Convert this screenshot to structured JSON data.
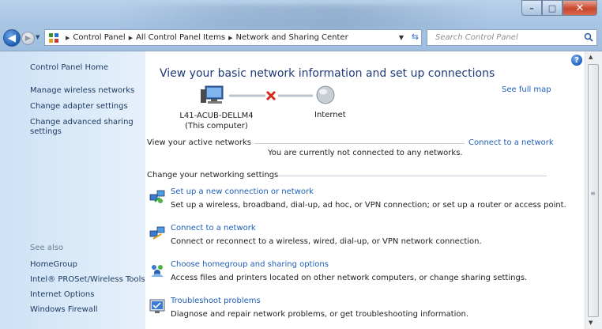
{
  "window": {
    "minimize_glyph": "–",
    "maximize_glyph": "□",
    "close_glyph": "✕"
  },
  "navigation": {
    "breadcrumbs": [
      "Control Panel",
      "All Control Panel Items",
      "Network and Sharing Center"
    ],
    "search_placeholder": "Search Control Panel"
  },
  "sidebar": {
    "home": "Control Panel Home",
    "links": [
      "Manage wireless networks",
      "Change adapter settings",
      "Change advanced sharing",
      "settings"
    ],
    "see_also_label": "See also",
    "see_also": [
      "HomeGroup",
      "Intel® PROSet/Wireless Tools",
      "Internet Options",
      "Windows Firewall"
    ]
  },
  "main": {
    "title": "View your basic network information and set up connections",
    "see_full_map": "See full map",
    "computer_name": "L41-ACUB-DELLM4",
    "computer_sub": "(This computer)",
    "internet_label": "Internet",
    "active_networks_label": "View your active networks",
    "connect_link": "Connect to a network",
    "not_connected": "You are currently not connected to any networks.",
    "settings_label": "Change your networking settings",
    "tasks": [
      {
        "title": "Set up a new connection or network",
        "desc": "Set up a wireless, broadband, dial-up, ad hoc, or VPN connection; or set up a router or access point.",
        "icon": "network-setup-icon"
      },
      {
        "title": "Connect to a network",
        "desc": "Connect or reconnect to a wireless, wired, dial-up, or VPN network connection.",
        "icon": "connect-network-icon"
      },
      {
        "title": "Choose homegroup and sharing options",
        "desc": "Access files and printers located on other network computers, or change sharing settings.",
        "icon": "homegroup-icon"
      },
      {
        "title": "Troubleshoot problems",
        "desc": "Diagnose and repair network problems, or get troubleshooting information.",
        "icon": "troubleshoot-icon"
      }
    ]
  },
  "colors": {
    "link": "#1e5eb7",
    "title": "#1e3b78",
    "sidebar_link": "#1e3b63",
    "disconnected_x": "#d42a1c"
  }
}
